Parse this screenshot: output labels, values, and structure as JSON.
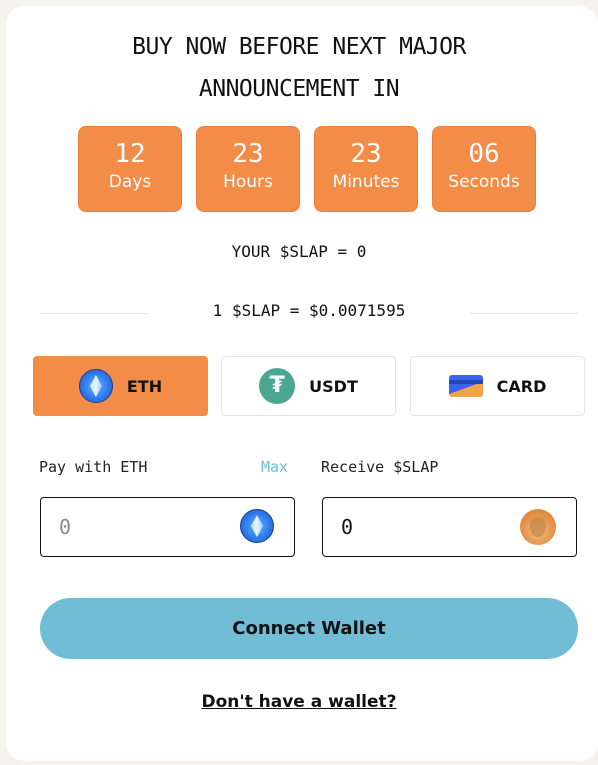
{
  "headline": {
    "line1": "BUY NOW BEFORE NEXT MAJOR",
    "line2": "ANNOUNCEMENT IN"
  },
  "countdown": [
    {
      "value": "12",
      "label": "Days"
    },
    {
      "value": "23",
      "label": "Hours"
    },
    {
      "value": "23",
      "label": "Minutes"
    },
    {
      "value": "06",
      "label": "Seconds"
    }
  ],
  "balance_text": "YOUR $SLAP = 0",
  "price_text": "1 $SLAP = $0.0071595",
  "payment_methods": [
    {
      "label": "ETH",
      "icon": "eth-icon",
      "active": true
    },
    {
      "label": "USDT",
      "icon": "usdt-icon",
      "active": false
    },
    {
      "label": "CARD",
      "icon": "card-icon",
      "active": false
    }
  ],
  "pay": {
    "label": "Pay with ETH",
    "max_label": "Max",
    "placeholder": "0",
    "icon": "eth-icon"
  },
  "receive": {
    "label": "Receive $SLAP",
    "value": "0",
    "icon": "slap-token-icon"
  },
  "connect_label": "Connect Wallet",
  "no_wallet_label": "Don't have a wallet?",
  "colors": {
    "accent_orange": "#f28c47",
    "button_blue": "#72bdd6",
    "link_blue": "#6fbfd6"
  }
}
